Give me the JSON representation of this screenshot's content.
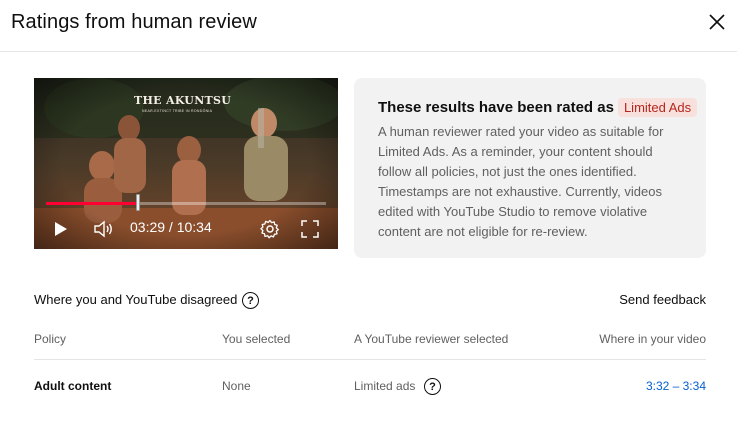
{
  "dialog": {
    "title": "Ratings from human review"
  },
  "video": {
    "overlay_title": "THE AKUNTSU",
    "overlay_subtitle": "NEAR-EXTINCT TRIBE IN RONDÔNIA",
    "current_time": "03:29",
    "separator": " / ",
    "duration": "10:34",
    "progress": 0.33
  },
  "result_card": {
    "heading": "These results have been rated as",
    "badge": "Limited Ads",
    "body": "A human reviewer rated your video as suitable for Limited Ads. As a reminder, your content should follow all policies, not just the ones identified. Timestamps are not exhaustive. Currently, videos edited with YouTube Studio to remove violative content are not eligible for re-review."
  },
  "disagreement": {
    "label": "Where you and YouTube disagreed",
    "help_glyph": "?",
    "send_feedback": "Send feedback"
  },
  "table": {
    "columns": [
      "Policy",
      "You selected",
      "A YouTube reviewer selected",
      "Where in your video"
    ],
    "rows": [
      {
        "policy": "Adult content",
        "you_selected": "None",
        "reviewer_selected": "Limited ads",
        "timestamp": "3:32 – 3:34"
      }
    ]
  },
  "colors": {
    "progress_played": "#ff0033",
    "badge_bg": "#f8e1dc",
    "badge_text": "#b3261e",
    "link": "#065fd4",
    "card_bg": "#f2f2f2"
  }
}
